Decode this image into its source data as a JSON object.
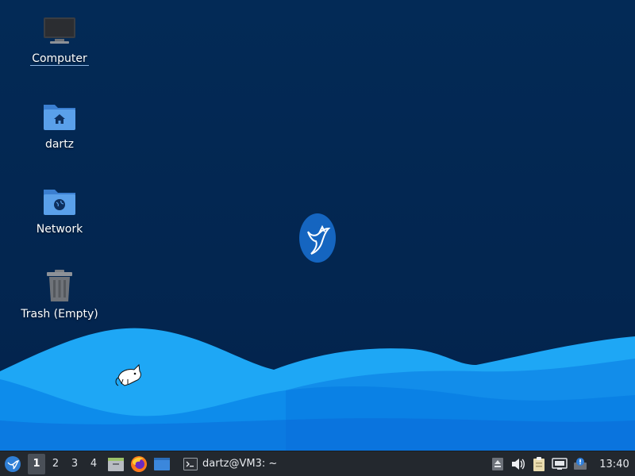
{
  "desktop": {
    "icons": [
      {
        "label": "Computer",
        "icon": "computer-icon"
      },
      {
        "label": "dartz",
        "icon": "home-folder-icon"
      },
      {
        "label": "Network",
        "icon": "network-folder-icon"
      },
      {
        "label": "Trash (Empty)",
        "icon": "trash-icon"
      }
    ],
    "selected_icon": "Computer",
    "colors": {
      "background": "#03254f",
      "wave_light": "#1ea7f5",
      "wave_mid": "#0a84e8",
      "wave_dark": "#075fcf",
      "logo_blue": "#1565c0"
    }
  },
  "taskbar": {
    "workspaces": [
      "1",
      "2",
      "3",
      "4"
    ],
    "active_workspace": "1",
    "launchers": [
      "file-manager-icon",
      "firefox-icon",
      "window-icon"
    ],
    "task": {
      "title": "dartz@VM3: ~",
      "icon": "terminal-icon"
    },
    "tray": [
      "eject-icon",
      "volume-icon",
      "clipboard-icon",
      "network-icon",
      "notification-icon"
    ],
    "clock": "13:40",
    "colors": {
      "background": "#23282e",
      "active_workspace": "#4a5058"
    }
  }
}
